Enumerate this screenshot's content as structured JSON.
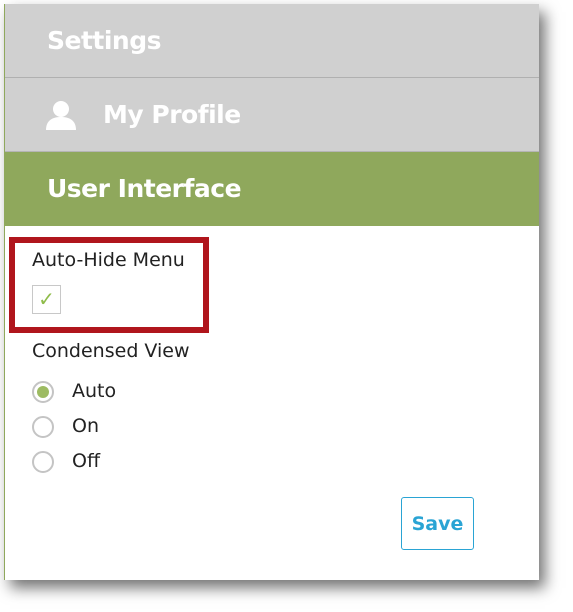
{
  "header": {
    "title": "Settings"
  },
  "nav": {
    "profile": {
      "label": "My Profile",
      "icon": "user-icon"
    },
    "user_interface": {
      "label": "User Interface",
      "active": true
    }
  },
  "form": {
    "auto_hide_menu": {
      "label": "Auto-Hide Menu",
      "checked": true,
      "check_glyph": "✓"
    },
    "condensed_view": {
      "label": "Condensed View",
      "options": [
        {
          "label": "Auto",
          "selected": true
        },
        {
          "label": "On",
          "selected": false
        },
        {
          "label": "Off",
          "selected": false
        }
      ]
    },
    "save_label": "Save"
  },
  "colors": {
    "header_bg": "#d0d0d0",
    "active_nav_bg": "#8fa85c",
    "accent_check": "#8fbc4a",
    "button_blue": "#2aa4d4",
    "highlight_red": "#b0151c"
  }
}
